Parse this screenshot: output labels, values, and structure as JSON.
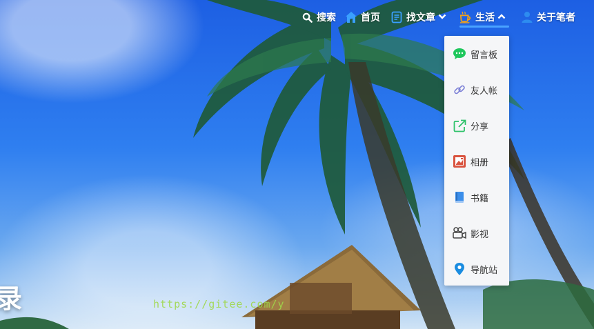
{
  "nav": {
    "search_label": "搜索",
    "home_label": "首页",
    "articles_label": "找文章",
    "life_label": "生活",
    "about_label": "关于笔者",
    "chevron_down": "▾",
    "chevron_up": "▴"
  },
  "dropdown": {
    "items": [
      {
        "label": "留言板",
        "icon": "chat-bubble-icon",
        "color": "#1fc75c"
      },
      {
        "label": "友人帐",
        "icon": "link-icon",
        "color": "#7b7fd6"
      },
      {
        "label": "分享",
        "icon": "share-icon",
        "color": "#2ec26a"
      },
      {
        "label": "相册",
        "icon": "photo-album-icon",
        "color": "#d9533f"
      },
      {
        "label": "书籍",
        "icon": "book-icon",
        "color": "#3b8eea"
      },
      {
        "label": "影视",
        "icon": "video-camera-icon",
        "color": "#444444"
      },
      {
        "label": "导航站",
        "icon": "location-pin-icon",
        "color": "#1a8ce0"
      }
    ]
  },
  "hero": {
    "title_fragment": "录",
    "watermark_text": "https://gitee.com/y"
  },
  "colors": {
    "nav_active_underline": "#4aa3ff",
    "home_icon": "#3aa0ff",
    "life_icon": "#f1a21b",
    "about_icon": "#2d8cf0"
  }
}
